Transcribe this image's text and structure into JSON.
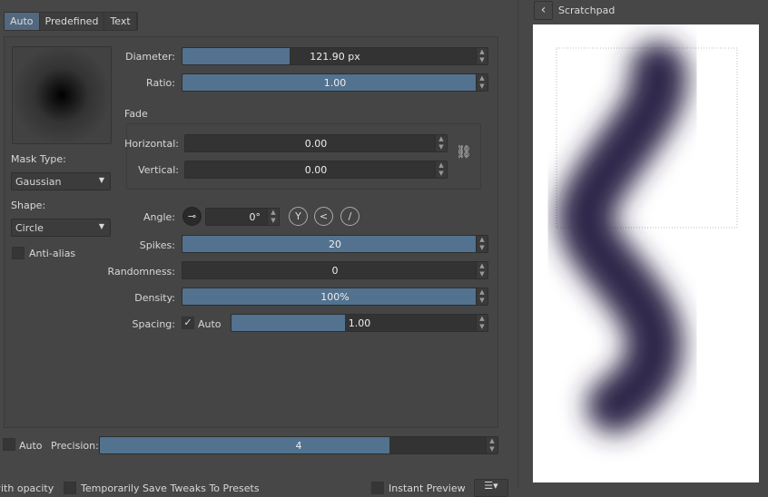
{
  "tabs": [
    {
      "label": "Auto",
      "active": true
    },
    {
      "label": "Predefined"
    },
    {
      "label": "Text"
    }
  ],
  "mask": {
    "mask_type_label": "Mask Type:",
    "mask_type": "Gaussian",
    "shape_label": "Shape:",
    "shape": "Circle",
    "antialias_label": "Anti-alias",
    "antialias": false
  },
  "diameter": {
    "label": "Diameter:",
    "value": "121.90 px",
    "fill": 0.34
  },
  "ratio": {
    "label": "Ratio:",
    "value": "1.00",
    "fill": 1.0
  },
  "fade": {
    "label": "Fade",
    "horizontal_label": "Horizontal:",
    "horizontal": "0.00",
    "vertical_label": "Vertical:",
    "vertical": "0.00",
    "linked": true
  },
  "angle": {
    "label": "Angle:",
    "value": "0°"
  },
  "spikes": {
    "label": "Spikes:",
    "value": "20",
    "fill": 1.0
  },
  "randomness": {
    "label": "Randomness:",
    "value": "0",
    "fill": 0
  },
  "density": {
    "label": "Density:",
    "value": "100%",
    "fill": 1.0
  },
  "spacing": {
    "label": "Spacing:",
    "auto_label": "Auto",
    "auto": true,
    "value": "1.00",
    "fill": 0.46
  },
  "precision": {
    "auto_label": "Auto",
    "auto": false,
    "label": "Precision:",
    "value": "4",
    "fill": 0.74
  },
  "footer": {
    "opacity_label": "with opacity",
    "save_tweaks_label": "Temporarily Save Tweaks To Presets",
    "instant_preview_label": "Instant Preview",
    "instant_preview": true
  },
  "scratchpad": {
    "title": "Scratchpad",
    "stroke_color": "#2e2648"
  },
  "colors": {
    "accent": "#52728f",
    "background": "#474747"
  }
}
